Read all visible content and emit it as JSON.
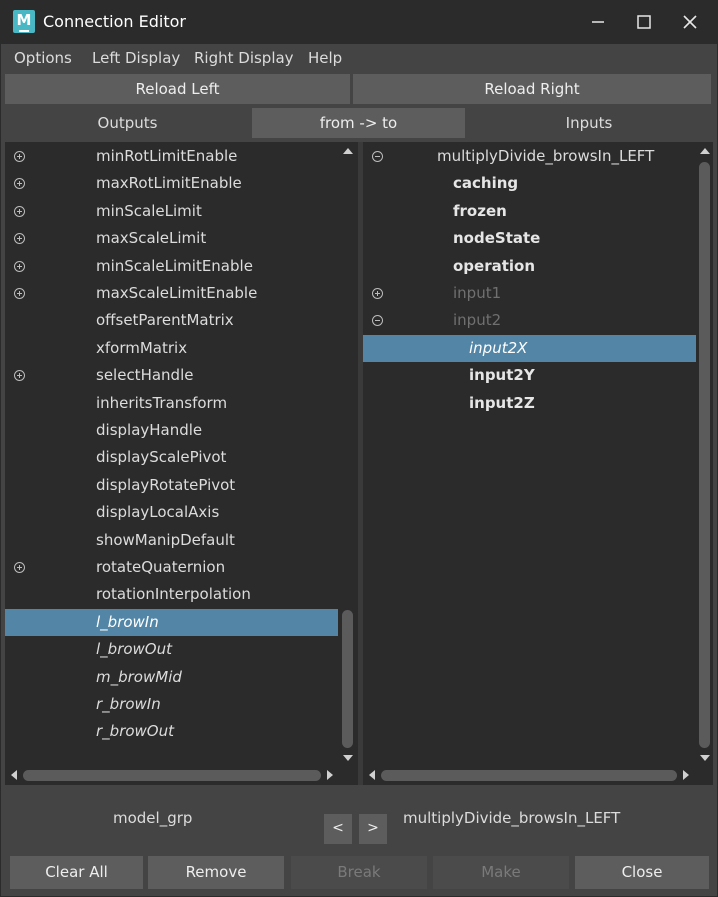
{
  "window": {
    "title": "Connection Editor",
    "app_icon_letter": "M"
  },
  "menubar": {
    "items": [
      "Options",
      "Left Display",
      "Right Display",
      "Help"
    ]
  },
  "reload": {
    "left_label": "Reload Left",
    "right_label": "Reload Right"
  },
  "tabs": {
    "outputs": "Outputs",
    "direction": "from -> to",
    "inputs": "Inputs"
  },
  "left_list": {
    "items": [
      {
        "label": "minRotLimitEnable",
        "expander": "plus",
        "italic": false,
        "selected": false
      },
      {
        "label": "maxRotLimitEnable",
        "expander": "plus",
        "italic": false,
        "selected": false
      },
      {
        "label": "minScaleLimit",
        "expander": "plus",
        "italic": false,
        "selected": false
      },
      {
        "label": "maxScaleLimit",
        "expander": "plus",
        "italic": false,
        "selected": false
      },
      {
        "label": "minScaleLimitEnable",
        "expander": "plus",
        "italic": false,
        "selected": false
      },
      {
        "label": "maxScaleLimitEnable",
        "expander": "plus",
        "italic": false,
        "selected": false
      },
      {
        "label": "offsetParentMatrix",
        "expander": "none",
        "italic": false,
        "selected": false
      },
      {
        "label": "xformMatrix",
        "expander": "none",
        "italic": false,
        "selected": false
      },
      {
        "label": "selectHandle",
        "expander": "plus",
        "italic": false,
        "selected": false
      },
      {
        "label": "inheritsTransform",
        "expander": "none",
        "italic": false,
        "selected": false
      },
      {
        "label": "displayHandle",
        "expander": "none",
        "italic": false,
        "selected": false
      },
      {
        "label": "displayScalePivot",
        "expander": "none",
        "italic": false,
        "selected": false
      },
      {
        "label": "displayRotatePivot",
        "expander": "none",
        "italic": false,
        "selected": false
      },
      {
        "label": "displayLocalAxis",
        "expander": "none",
        "italic": false,
        "selected": false
      },
      {
        "label": "showManipDefault",
        "expander": "none",
        "italic": false,
        "selected": false
      },
      {
        "label": "rotateQuaternion",
        "expander": "plus",
        "italic": false,
        "selected": false
      },
      {
        "label": "rotationInterpolation",
        "expander": "none",
        "italic": false,
        "selected": false
      },
      {
        "label": "l_browIn",
        "expander": "none",
        "italic": true,
        "selected": true
      },
      {
        "label": "l_browOut",
        "expander": "none",
        "italic": true,
        "selected": false
      },
      {
        "label": "m_browMid",
        "expander": "none",
        "italic": true,
        "selected": false
      },
      {
        "label": "r_browIn",
        "expander": "none",
        "italic": true,
        "selected": false
      },
      {
        "label": "r_browOut",
        "expander": "none",
        "italic": true,
        "selected": false
      }
    ]
  },
  "right_list": {
    "items": [
      {
        "label": "multiplyDivide_browsIn_LEFT",
        "expander": "minus",
        "style": "normal",
        "indent": 0,
        "selected": false
      },
      {
        "label": "caching",
        "expander": "none",
        "style": "bold",
        "indent": 1,
        "selected": false
      },
      {
        "label": "frozen",
        "expander": "none",
        "style": "bold",
        "indent": 1,
        "selected": false
      },
      {
        "label": "nodeState",
        "expander": "none",
        "style": "bold",
        "indent": 1,
        "selected": false
      },
      {
        "label": "operation",
        "expander": "none",
        "style": "bold",
        "indent": 1,
        "selected": false
      },
      {
        "label": "input1",
        "expander": "plus",
        "style": "dim",
        "indent": 1,
        "selected": false
      },
      {
        "label": "input2",
        "expander": "minus",
        "style": "dim",
        "indent": 1,
        "selected": false
      },
      {
        "label": "input2X",
        "expander": "none",
        "style": "italic",
        "indent": 2,
        "selected": true
      },
      {
        "label": "input2Y",
        "expander": "none",
        "style": "bold",
        "indent": 2,
        "selected": false
      },
      {
        "label": "input2Z",
        "expander": "none",
        "style": "bold",
        "indent": 2,
        "selected": false
      }
    ]
  },
  "footer": {
    "left_node": "model_grp",
    "right_node": "multiplyDivide_browsIn_LEFT",
    "prev_label": "<",
    "next_label": ">"
  },
  "buttons": {
    "clear_all": "Clear All",
    "remove": "Remove",
    "break": "Break",
    "make": "Make",
    "close": "Close"
  },
  "colors": {
    "selection": "#5285a6",
    "panel_bg": "#2b2b2b",
    "window_bg": "#444444",
    "button_bg": "#5d5d5d"
  }
}
